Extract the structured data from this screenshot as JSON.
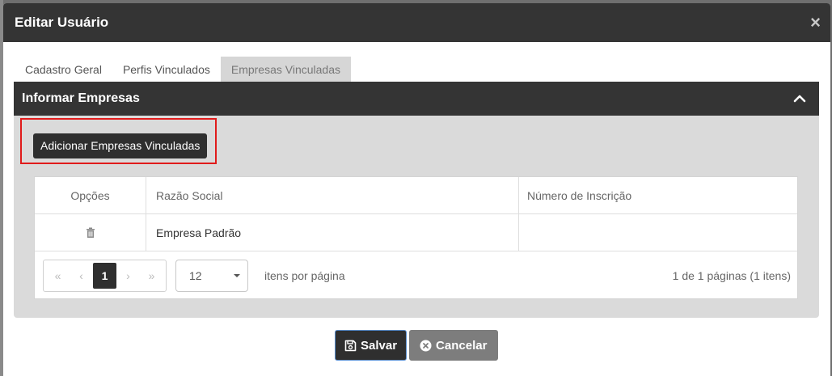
{
  "modal": {
    "title": "Editar Usuário",
    "close_label": "×"
  },
  "tabs": [
    {
      "label": "Cadastro Geral",
      "active": false
    },
    {
      "label": "Perfis Vinculados",
      "active": false
    },
    {
      "label": "Empresas Vinculadas",
      "active": true
    }
  ],
  "panel": {
    "title": "Informar Empresas",
    "add_button_label": "Adicionar Empresas Vinculadas"
  },
  "grid": {
    "columns": [
      "Opções",
      "Razão Social",
      "Número de Inscrição"
    ],
    "rows": [
      {
        "razao_social": "Empresa Padrão",
        "numero_inscricao": ""
      }
    ]
  },
  "pager": {
    "first": "«",
    "prev": "‹",
    "current_page": "1",
    "next": "›",
    "last": "»",
    "page_size": "12",
    "per_page_label": "itens por página",
    "info": "1 de 1 páginas (1 itens)"
  },
  "footer": {
    "save_label": "Salvar",
    "cancel_label": "Cancelar"
  },
  "colors": {
    "header_bg": "#343434",
    "highlight": "#e01b1b",
    "save_border": "#5a8fd0"
  }
}
